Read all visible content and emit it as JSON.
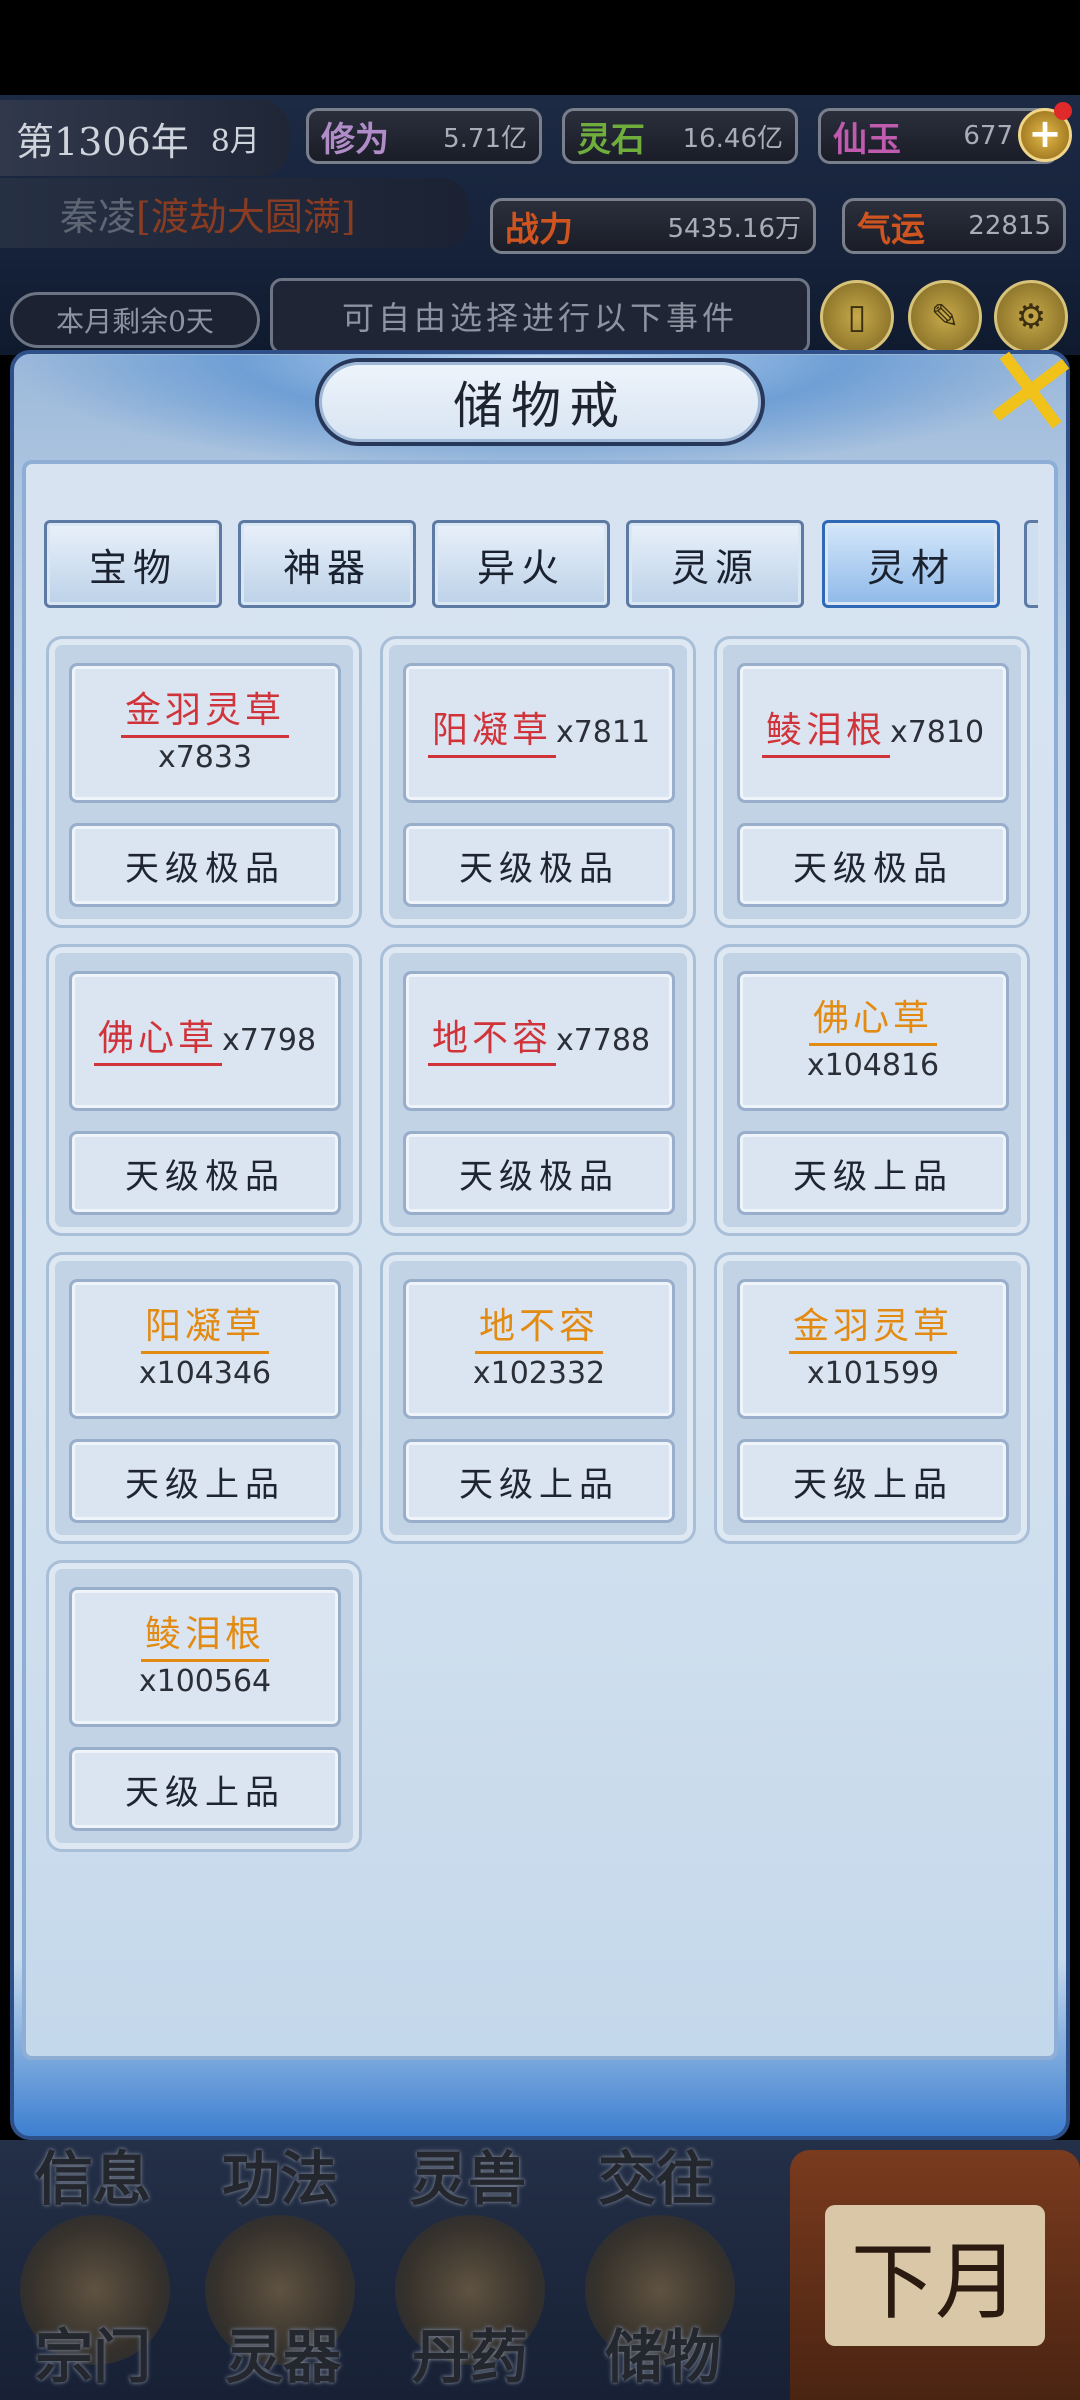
{
  "hud": {
    "year": "第1306年",
    "month": "8月",
    "character_name": "秦凌",
    "realm": "[渡劫大圆满]",
    "stats": [
      {
        "label": "修为",
        "value": "5.71亿",
        "color": "#b08cc8"
      },
      {
        "label": "灵石",
        "value": "16.46亿",
        "color": "#6fae3c"
      },
      {
        "label": "仙玉",
        "value": "677",
        "color": "#c05bb0"
      },
      {
        "label": "战力",
        "value": "5435.16万",
        "color": "#d0541f"
      },
      {
        "label": "气运",
        "value": "22815",
        "color": "#d0541f"
      }
    ],
    "days_remaining": "本月剩余0天",
    "event_prompt": "可自由选择进行以下事件",
    "plus_icon": "plus-icon",
    "round_buttons": [
      "card-icon",
      "brush-icon",
      "gear-icon"
    ]
  },
  "panel": {
    "title": "储物戒",
    "close_icon": "close-icon",
    "tabs": [
      {
        "label": "宝物",
        "active": false
      },
      {
        "label": "神器",
        "active": false
      },
      {
        "label": "异火",
        "active": false
      },
      {
        "label": "灵源",
        "active": false
      },
      {
        "label": "灵材",
        "active": true
      }
    ],
    "items": [
      {
        "name": "金羽灵草",
        "qty": "x7833",
        "grade": "天级极品",
        "color": "red",
        "layout": "stacked"
      },
      {
        "name": "阳凝草",
        "qty": "x7811",
        "grade": "天级极品",
        "color": "red",
        "layout": "inline"
      },
      {
        "name": "鲮泪根",
        "qty": "x7810",
        "grade": "天级极品",
        "color": "red",
        "layout": "inline"
      },
      {
        "name": "佛心草",
        "qty": "x7798",
        "grade": "天级极品",
        "color": "red",
        "layout": "inline"
      },
      {
        "name": "地不容",
        "qty": "x7788",
        "grade": "天级极品",
        "color": "red",
        "layout": "inline"
      },
      {
        "name": "佛心草",
        "qty": "x104816",
        "grade": "天级上品",
        "color": "orange",
        "layout": "stacked"
      },
      {
        "name": "阳凝草",
        "qty": "x104346",
        "grade": "天级上品",
        "color": "orange",
        "layout": "stacked"
      },
      {
        "name": "地不容",
        "qty": "x102332",
        "grade": "天级上品",
        "color": "orange",
        "layout": "stacked"
      },
      {
        "name": "金羽灵草",
        "qty": "x101599",
        "grade": "天级上品",
        "color": "orange",
        "layout": "stacked"
      },
      {
        "name": "鲮泪根",
        "qty": "x100564",
        "grade": "天级上品",
        "color": "orange",
        "layout": "stacked"
      }
    ]
  },
  "bottom_nav": {
    "top_row": [
      "信息",
      "功法",
      "灵兽",
      "交往"
    ],
    "bottom_row": [
      "宗门",
      "灵器",
      "丹药",
      "储物"
    ],
    "next_month": "下月"
  }
}
